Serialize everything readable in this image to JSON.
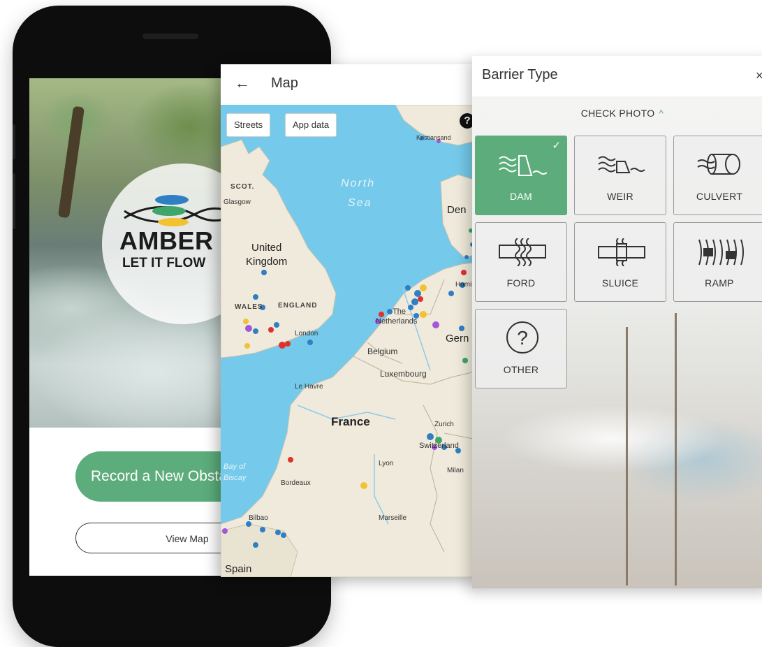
{
  "phone": {
    "logo_title": "AMBER",
    "logo_tagline": "LET IT FLOW",
    "record_button": "Record a New Obstacle",
    "view_map_button": "View Map",
    "accent_color": "#5cad7b"
  },
  "map": {
    "title": "Map",
    "back_icon": "arrow-left-icon",
    "chips": [
      "Streets",
      "App data"
    ],
    "help_label": "?",
    "labels": {
      "scot": "SCOT.",
      "glasgow": "Glasgow",
      "north_sea_1": "North",
      "north_sea_2": "Sea",
      "denmark": "Den",
      "united": "United",
      "kingdom": "Kingdom",
      "wales": "WALES",
      "england": "ENGLAND",
      "london": "London",
      "netherlands_the": "The",
      "netherlands": "Netherlands",
      "hamburg": "Hami",
      "germany": "Gern",
      "belgium": "Belgium",
      "luxembourg": "Luxembourg",
      "le_havre": "Le Havre",
      "france": "France",
      "zurich": "Zurich",
      "switzerland": "Switzerland",
      "bay_of": "Bay of",
      "biscay": "Biscay",
      "lyon": "Lyon",
      "milan": "Milan",
      "bordeaux": "Bordeaux",
      "marseille": "Marseille",
      "bilbao": "Bilbao",
      "spain": "Spain",
      "kristiansand": "Kristiansand"
    }
  },
  "barrier": {
    "title": "Barrier Type",
    "close_label": "×",
    "check_photo": "CHECK PHOTO",
    "check_photo_chevron": "^",
    "selected": "DAM",
    "types": [
      {
        "label": "DAM",
        "icon": "dam-icon",
        "selected": true
      },
      {
        "label": "WEIR",
        "icon": "weir-icon",
        "selected": false
      },
      {
        "label": "CULVERT",
        "icon": "culvert-icon",
        "selected": false
      },
      {
        "label": "FORD",
        "icon": "ford-icon",
        "selected": false
      },
      {
        "label": "SLUICE",
        "icon": "sluice-icon",
        "selected": false
      },
      {
        "label": "RAMP",
        "icon": "ramp-icon",
        "selected": false
      },
      {
        "label": "OTHER",
        "icon": "question-circle-icon",
        "selected": false
      }
    ],
    "check_mark": "✓"
  }
}
